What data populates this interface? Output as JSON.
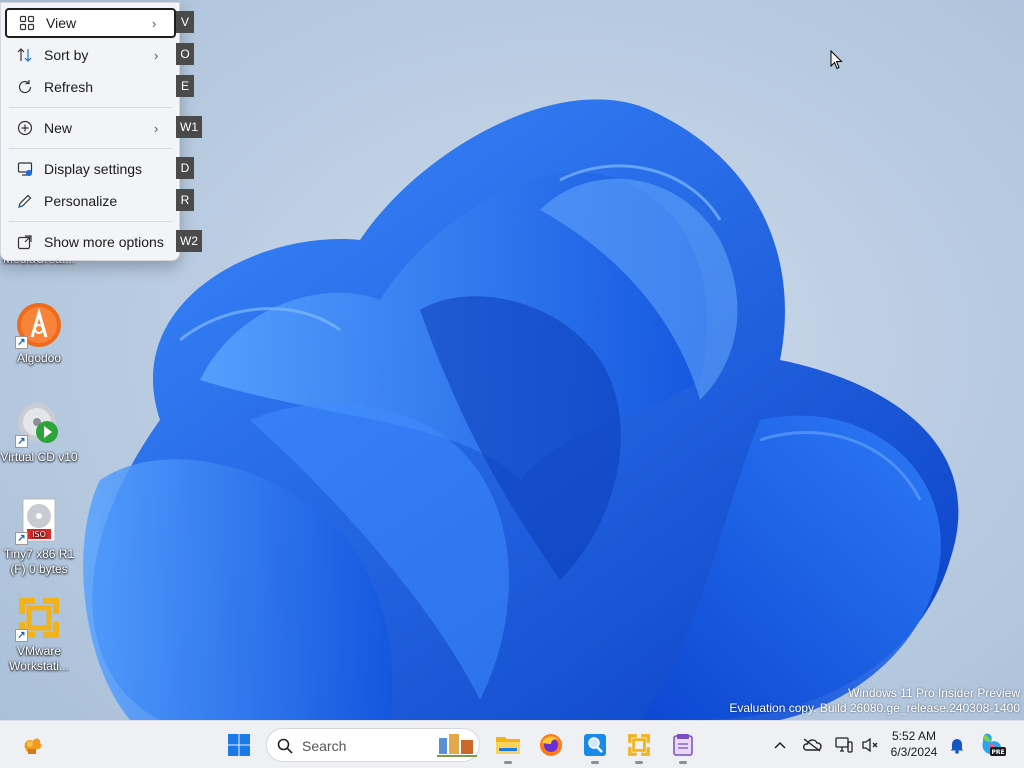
{
  "context_menu": {
    "items": [
      {
        "label": "View",
        "icon": "grid-view-icon",
        "submenu": true,
        "accel": "V"
      },
      {
        "label": "Sort by",
        "icon": "sort-arrows-icon",
        "submenu": true,
        "accel": "O"
      },
      {
        "label": "Refresh",
        "icon": "refresh-icon",
        "submenu": false,
        "accel": "E"
      },
      {
        "label": "New",
        "icon": "plus-circle-icon",
        "submenu": true,
        "accel": "W1"
      },
      {
        "label": "Display settings",
        "icon": "display-settings-icon",
        "submenu": false,
        "accel": "D"
      },
      {
        "label": "Personalize",
        "icon": "pen-icon",
        "submenu": false,
        "accel": "R"
      },
      {
        "label": "Show more options",
        "icon": "share-box-icon",
        "submenu": false,
        "accel": "W2"
      }
    ]
  },
  "desktop_icons": [
    {
      "label": "MediaCreat...",
      "icon": "media-creation-tool-icon"
    },
    {
      "label": "Algodoo",
      "icon": "algodoo-icon"
    },
    {
      "label": "Virtual CD v10",
      "icon": "virtual-cd-icon"
    },
    {
      "label": "Tiny7 x86 R1 (F) 0 bytes",
      "icon": "iso-disc-icon"
    },
    {
      "label": "VMware Workstati...",
      "icon": "vmware-icon"
    }
  ],
  "watermark": {
    "line1": "Windows 11 Pro Insider Preview",
    "line2": "Evaluation copy. Build 26080.ge_release.240308-1400"
  },
  "taskbar": {
    "search_label": "Search",
    "apps": [
      "widgets-icon",
      "start-icon",
      "file-explorer-icon",
      "firefox-icon",
      "magnifier-app-icon",
      "vmware-taskbar-icon",
      "notepad-icon"
    ],
    "tray": [
      "chevron-up-icon",
      "onedrive-icon",
      "network-icon",
      "volume-icon"
    ],
    "clock": {
      "time": "5:52 AM",
      "date": "6/3/2024"
    }
  },
  "colors": {
    "accent": "#0f6cd9",
    "bloom": "#1e6cf0",
    "menu_bg": "#f3f4f7",
    "taskbar_bg": "#eef0f4"
  }
}
